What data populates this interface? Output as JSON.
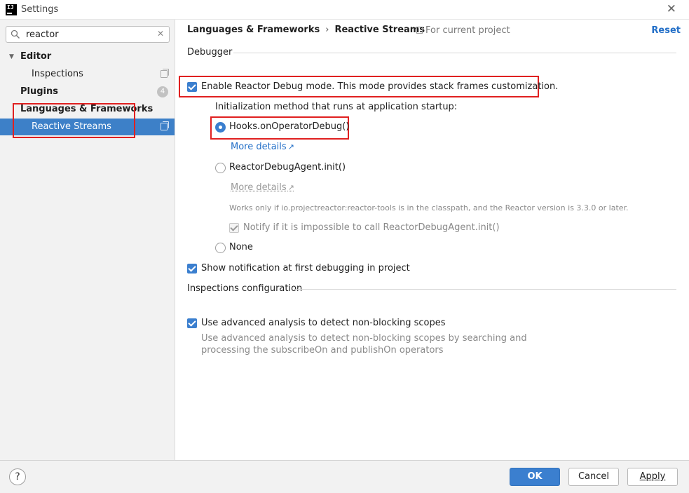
{
  "window": {
    "title": "Settings",
    "app_icon_text": "IJ"
  },
  "search": {
    "value": "reactor"
  },
  "sidebar": {
    "items": [
      {
        "label": "Editor",
        "bold": true,
        "expanded": true
      },
      {
        "label": "Inspections",
        "bold": false
      },
      {
        "label": "Plugins",
        "bold": true,
        "badge": "4"
      },
      {
        "label": "Languages & Frameworks",
        "bold": true
      },
      {
        "label": "Reactive Streams",
        "bold": false,
        "selected": true
      }
    ]
  },
  "header": {
    "breadcrumb": [
      "Languages & Frameworks",
      "Reactive Streams"
    ],
    "scope_hint": "For current project",
    "reset_label": "Reset"
  },
  "debugger": {
    "section_title": "Debugger",
    "enable_debug_label": "Enable Reactor Debug mode. This mode provides stack frames customization.",
    "enable_debug_checked": true,
    "init_method_label": "Initialization method that runs at application startup:",
    "options": [
      {
        "label": "Hooks.onOperatorDebug()",
        "selected": true,
        "more_details": "More details"
      },
      {
        "label": "ReactorDebugAgent.init()",
        "selected": false,
        "more_details": "More details",
        "note": "Works only if io.projectreactor:reactor-tools is in the classpath, and the Reactor version is 3.3.0 or later.",
        "notify_label": "Notify if it is impossible to call ReactorDebugAgent.init()",
        "notify_checked": true
      },
      {
        "label": "None",
        "selected": false
      }
    ],
    "show_notification_label": "Show notification at first debugging in project",
    "show_notification_checked": true
  },
  "inspections": {
    "section_title": "Inspections configuration",
    "advanced_label": "Use advanced analysis to detect non-blocking scopes",
    "advanced_checked": true,
    "advanced_desc_line1": "Use advanced analysis to detect non-blocking scopes by searching and",
    "advanced_desc_line2": "processing the subscribeOn and publishOn operators"
  },
  "footer": {
    "help_label": "?",
    "ok_label": "OK",
    "cancel_label": "Cancel",
    "apply_label": "Apply"
  },
  "colors": {
    "accent": "#3b7fcf",
    "link": "#2470c8",
    "selection": "#3d80c8",
    "annotation": "#e02020"
  }
}
